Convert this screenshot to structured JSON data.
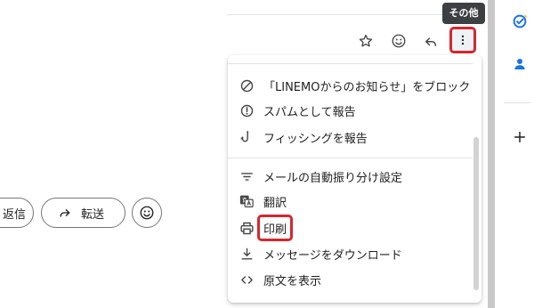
{
  "tooltip": {
    "text": "その他"
  },
  "toolbar": {
    "icons": [
      "star-icon",
      "emoji-icon",
      "reply-icon",
      "more-vert-icon"
    ]
  },
  "actions": {
    "reply_label": "返信",
    "forward_label": "転送"
  },
  "menu": {
    "items": [
      {
        "label": "「LINEMOからのお知らせ」をブロック",
        "icon": "block-icon"
      },
      {
        "label": "スパムとして報告",
        "icon": "report-icon"
      },
      {
        "label": "フィッシングを報告",
        "icon": "phishing-hook-icon"
      },
      {
        "label": "メールの自動振り分け設定",
        "icon": "filter-icon"
      },
      {
        "label": "翻訳",
        "icon": "translate-icon"
      },
      {
        "label": "印刷",
        "icon": "print-icon"
      },
      {
        "label": "メッセージをダウンロード",
        "icon": "download-icon"
      },
      {
        "label": "原文を表示",
        "icon": "code-icon"
      }
    ]
  },
  "rail": {
    "icons": [
      "tasks-icon",
      "contacts-icon",
      "add-icon"
    ]
  },
  "colors": {
    "highlight": "#d7262d",
    "tasks": "#1a73e8",
    "contacts": "#1a73e8",
    "tooltip_bg": "#3c4043"
  }
}
